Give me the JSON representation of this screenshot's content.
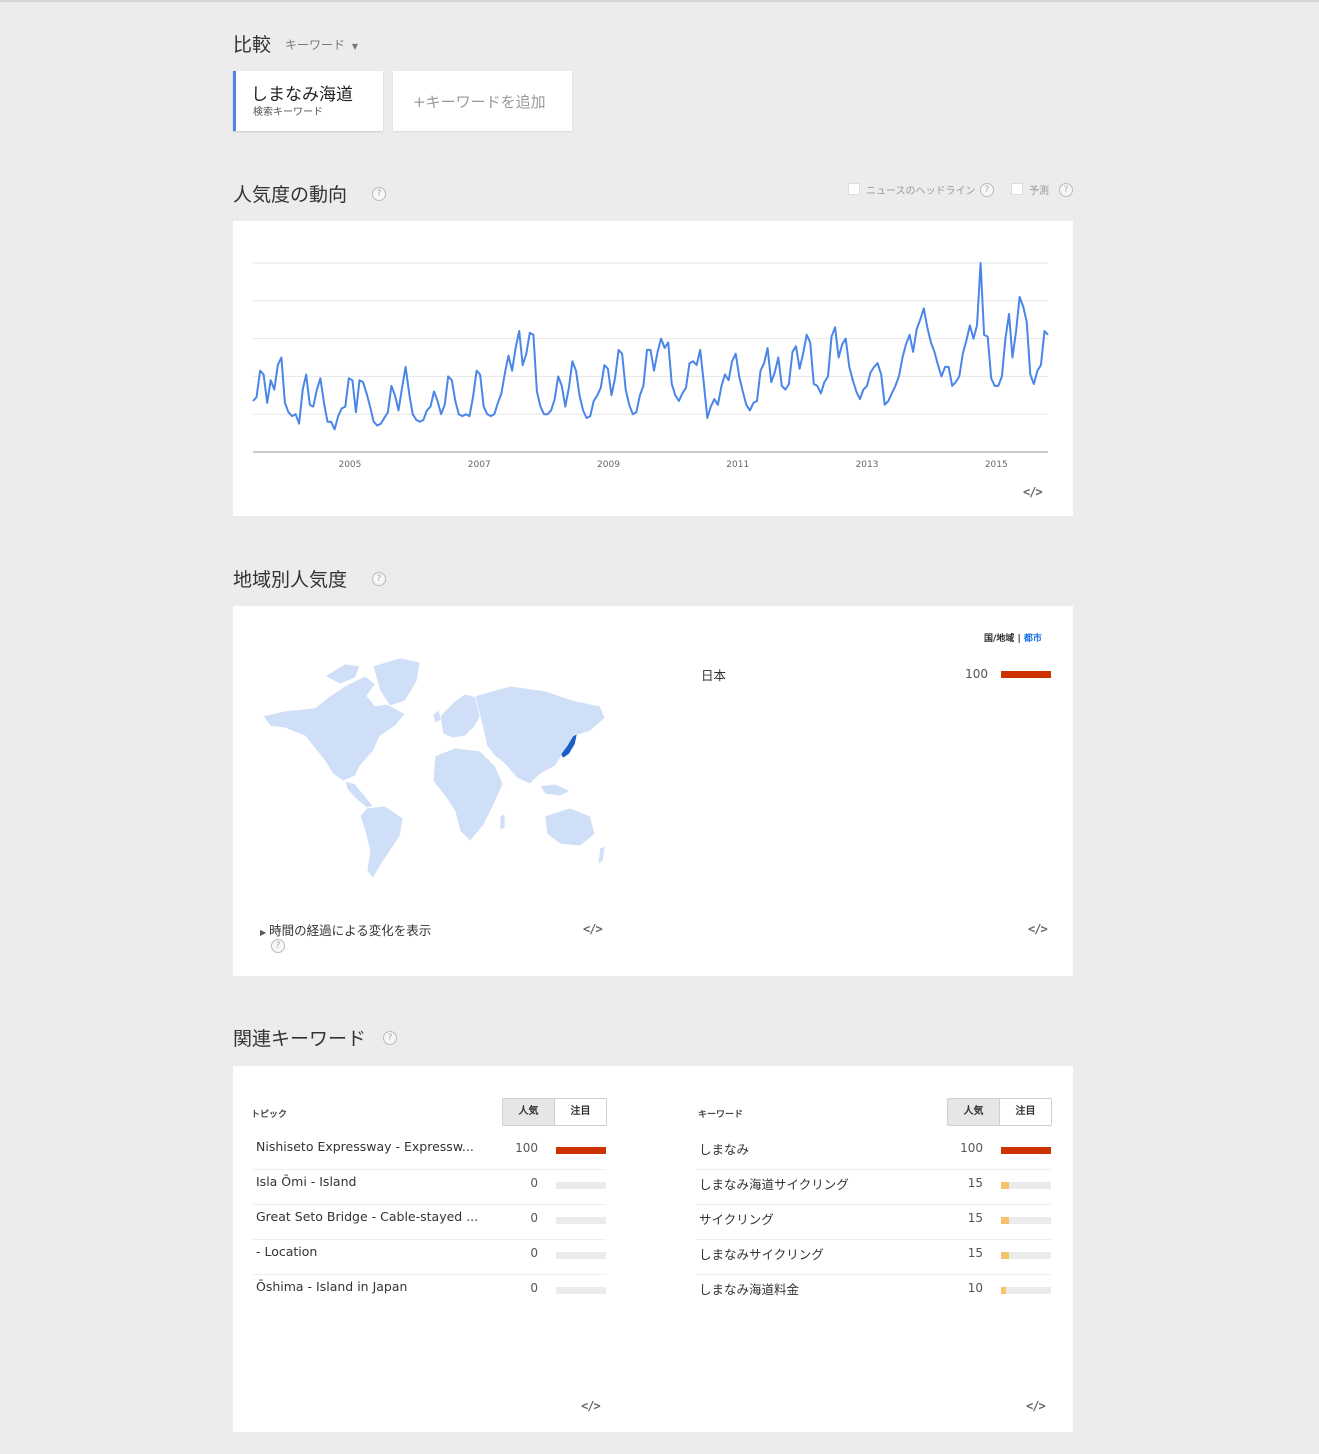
{
  "compare": {
    "label": "比較",
    "dropdown": "キーワード",
    "term": {
      "name": "しまなみ海道",
      "sub": "検索キーワード"
    },
    "add": "+キーワードを追加"
  },
  "interest": {
    "title": "人気度の動向",
    "help": "?",
    "news_label": "ニュースのヘッドライン",
    "forecast_label": "予測",
    "embed": "</>",
    "x_ticks": [
      "2005",
      "2007",
      "2009",
      "2011",
      "2013",
      "2015"
    ]
  },
  "chart_data": {
    "type": "line",
    "title": "",
    "xlabel": "",
    "ylabel": "",
    "ylim": [
      0,
      100
    ],
    "grid": true,
    "color": "#4a86e8",
    "x_ticks": [
      "2005",
      "2007",
      "2009",
      "2011",
      "2013",
      "2015"
    ],
    "x_range": [
      2004.0,
      2016.3
    ],
    "series": [
      {
        "name": "しまなみ海道",
        "values": [
          27,
          29,
          43,
          41,
          26,
          38,
          33,
          46,
          50,
          26,
          21,
          19,
          20,
          15,
          33,
          41,
          25,
          24,
          33,
          39,
          26,
          16,
          16,
          12,
          19,
          23,
          24,
          39,
          38,
          21,
          38,
          37,
          31,
          24,
          16,
          14,
          15,
          18,
          21,
          35,
          30,
          22,
          34,
          45,
          31,
          20,
          17,
          16,
          17,
          22,
          24,
          32,
          27,
          20,
          25,
          40,
          38,
          27,
          20,
          19,
          20,
          19,
          29,
          43,
          41,
          24,
          20,
          19,
          20,
          26,
          31,
          42,
          51,
          43,
          55,
          64,
          46,
          52,
          63,
          62,
          32,
          24,
          20,
          20,
          22,
          28,
          40,
          35,
          24,
          34,
          48,
          43,
          30,
          22,
          18,
          19,
          27,
          30,
          34,
          46,
          44,
          30,
          39,
          54,
          52,
          33,
          25,
          20,
          21,
          30,
          35,
          54,
          54,
          43,
          53,
          60,
          55,
          58,
          36,
          30,
          27,
          31,
          34,
          47,
          48,
          46,
          54,
          37,
          18,
          24,
          28,
          25,
          35,
          41,
          38,
          48,
          52,
          40,
          32,
          25,
          22,
          26,
          27,
          43,
          47,
          55,
          37,
          42,
          50,
          35,
          33,
          36,
          53,
          56,
          44,
          52,
          62,
          58,
          36,
          35,
          31,
          37,
          40,
          61,
          66,
          50,
          57,
          60,
          45,
          38,
          32,
          28,
          33,
          35,
          42,
          45,
          47,
          41,
          25,
          27,
          31,
          35,
          40,
          50,
          57,
          62,
          53,
          65,
          70,
          76,
          66,
          58,
          53,
          46,
          40,
          45,
          45,
          35,
          37,
          40,
          52,
          59,
          67,
          60,
          67,
          100,
          62,
          61,
          39,
          35,
          35,
          40,
          60,
          73,
          50,
          64,
          82,
          77,
          69,
          41,
          36,
          43,
          46,
          64,
          62
        ]
      }
    ]
  },
  "region": {
    "title": "地域別人気度",
    "help": "?",
    "toggle_country": "国/地域",
    "toggle_sep": "|",
    "toggle_city": "都市",
    "time_link": "時間の経過による変化を表示",
    "embed_left": "</>",
    "embed_right": "</>",
    "rows": [
      {
        "name": "日本",
        "value": 100
      }
    ],
    "bar_color": "#cc3300"
  },
  "related": {
    "title": "関連キーワード",
    "help": "?",
    "topics": {
      "header": "トピック",
      "toggle_top": "人気",
      "toggle_rising": "注目",
      "embed": "</>",
      "rows": [
        {
          "label": "Nishiseto Expressway - Expressw...",
          "value": 100
        },
        {
          "label": "Isla Ōmi - Island",
          "value": 0
        },
        {
          "label": "Great Seto Bridge - Cable-stayed ...",
          "value": 0
        },
        {
          "label": "- Location",
          "value": 0
        },
        {
          "label": "Ōshima - Island in Japan",
          "value": 0
        }
      ]
    },
    "keywords": {
      "header": "キーワード",
      "toggle_top": "人気",
      "toggle_rising": "注目",
      "embed": "</>",
      "rows": [
        {
          "label": "しまなみ",
          "value": 100
        },
        {
          "label": "しまなみ海道サイクリング",
          "value": 15
        },
        {
          "label": "サイクリング",
          "value": 15
        },
        {
          "label": "しまなみサイクリング",
          "value": 15
        },
        {
          "label": "しまなみ海道料金",
          "value": 10
        }
      ]
    },
    "bar_color_high": "#cc3300",
    "bar_color_low": "#f6c26b"
  }
}
